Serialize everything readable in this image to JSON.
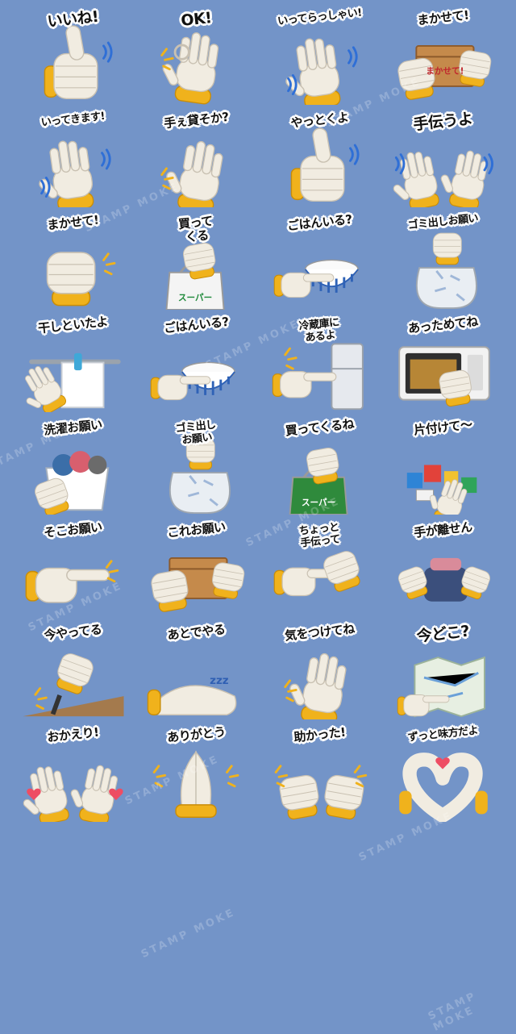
{
  "watermark_text": "STAMP MOKE",
  "stickers": [
    {
      "caption": "いいね!",
      "icon": "thumbs-up-glove-icon"
    },
    {
      "caption": "OK!",
      "icon": "ok-sign-glove-icon"
    },
    {
      "caption": "いってらっしゃい!",
      "icon": "waving-glove-icon"
    },
    {
      "caption": "まかせて!",
      "icon": "glove-holding-box-icon",
      "prop_label": "まかせて!"
    },
    {
      "caption": "いってきます!",
      "icon": "waving-glove-icon"
    },
    {
      "caption": "手ぇ貸そか?",
      "icon": "open-glove-icon"
    },
    {
      "caption": "やっとくよ",
      "icon": "thumbs-up-glove-icon"
    },
    {
      "caption": "手伝うよ",
      "icon": "two-gloves-icon"
    },
    {
      "caption": "まかせて!",
      "icon": "fist-glove-icon"
    },
    {
      "caption": "買って\nくる",
      "icon": "glove-holding-bag-icon",
      "prop_label": "スーパー"
    },
    {
      "caption": "ごはんいる?",
      "icon": "glove-holding-rice-bowl-icon"
    },
    {
      "caption": "ゴミ出しお願い",
      "icon": "glove-holding-trash-bag-icon"
    },
    {
      "caption": "干しといたよ",
      "icon": "glove-hanging-towel-icon"
    },
    {
      "caption": "ごはんいる?",
      "icon": "glove-holding-rice-bowl-icon"
    },
    {
      "caption": "冷蔵庫に\nあるよ",
      "icon": "glove-pointing-fridge-icon"
    },
    {
      "caption": "あっためてね",
      "icon": "glove-microwave-icon"
    },
    {
      "caption": "洗濯お願い",
      "icon": "glove-laundry-basket-icon"
    },
    {
      "caption": "ゴミ出し\nお願い",
      "icon": "glove-holding-trash-bag-icon"
    },
    {
      "caption": "買ってくるね",
      "icon": "glove-holding-bag-icon",
      "prop_label": "スーパー"
    },
    {
      "caption": "片付けて〜",
      "icon": "glove-toys-icon"
    },
    {
      "caption": "そこお願い",
      "icon": "pointing-glove-icon"
    },
    {
      "caption": "これお願い",
      "icon": "glove-holding-box-icon"
    },
    {
      "caption": "ちょっと\n手伝って",
      "icon": "two-gloves-handshake-icon"
    },
    {
      "caption": "手が離せん",
      "icon": "glove-holding-laundry-icon"
    },
    {
      "caption": "今やってる",
      "icon": "glove-screwdriver-icon"
    },
    {
      "caption": "あとでやる",
      "icon": "sleeping-glove-icon",
      "prop_label": "zzz"
    },
    {
      "caption": "気をつけてね",
      "icon": "open-glove-icon"
    },
    {
      "caption": "今どこ?",
      "icon": "glove-map-icon"
    },
    {
      "caption": "おかえり!",
      "icon": "two-gloves-waving-icon"
    },
    {
      "caption": "ありがとう",
      "icon": "praying-gloves-icon"
    },
    {
      "caption": "助かった!",
      "icon": "two-fists-gloves-icon"
    },
    {
      "caption": "ずっと味方だよ",
      "icon": "heart-hands-gloves-icon"
    }
  ]
}
